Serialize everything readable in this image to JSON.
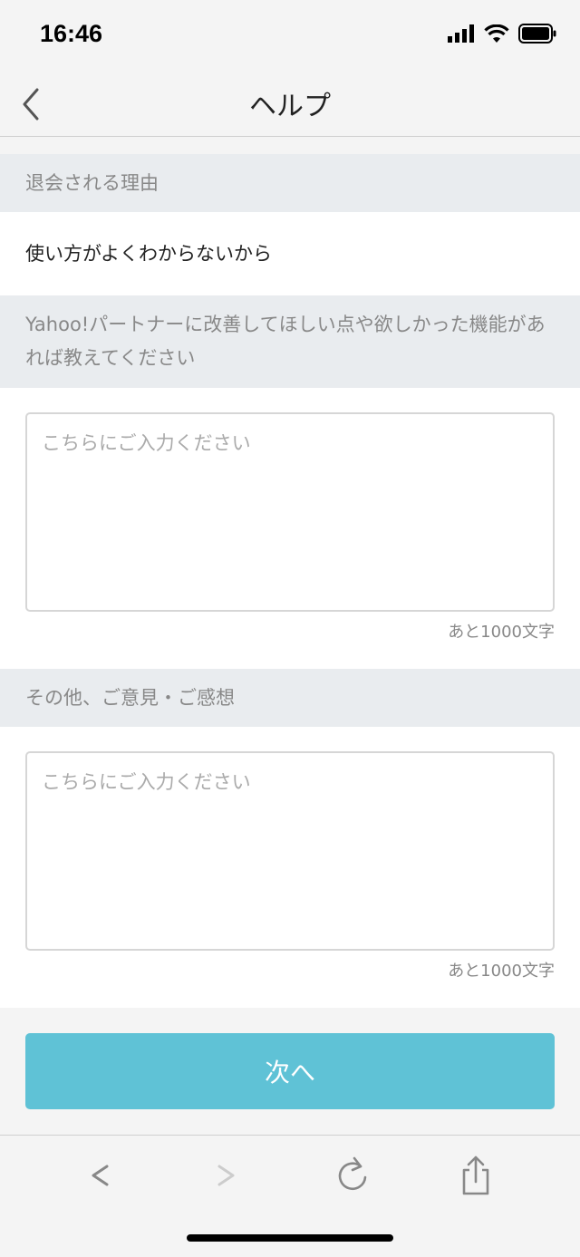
{
  "status_bar": {
    "time": "16:46"
  },
  "nav": {
    "title": "ヘルプ"
  },
  "sections": {
    "reason": {
      "header": "退会される理由",
      "value": "使い方がよくわからないから"
    },
    "improvement": {
      "header": "Yahoo!パートナーに改善してほしい点や欲しかった機能があれば教えてください",
      "placeholder": "こちらにご入力ください",
      "counter": "あと1000文字"
    },
    "other": {
      "header": "その他、ご意見・ご感想",
      "placeholder": "こちらにご入力ください",
      "counter": "あと1000文字"
    }
  },
  "next_button": {
    "label": "次へ"
  },
  "colors": {
    "accent": "#5fc2d6",
    "section_bg": "#e9ecef"
  },
  "toolbar": {
    "icons": [
      "back-icon",
      "forward-icon",
      "reload-icon",
      "share-icon"
    ]
  }
}
